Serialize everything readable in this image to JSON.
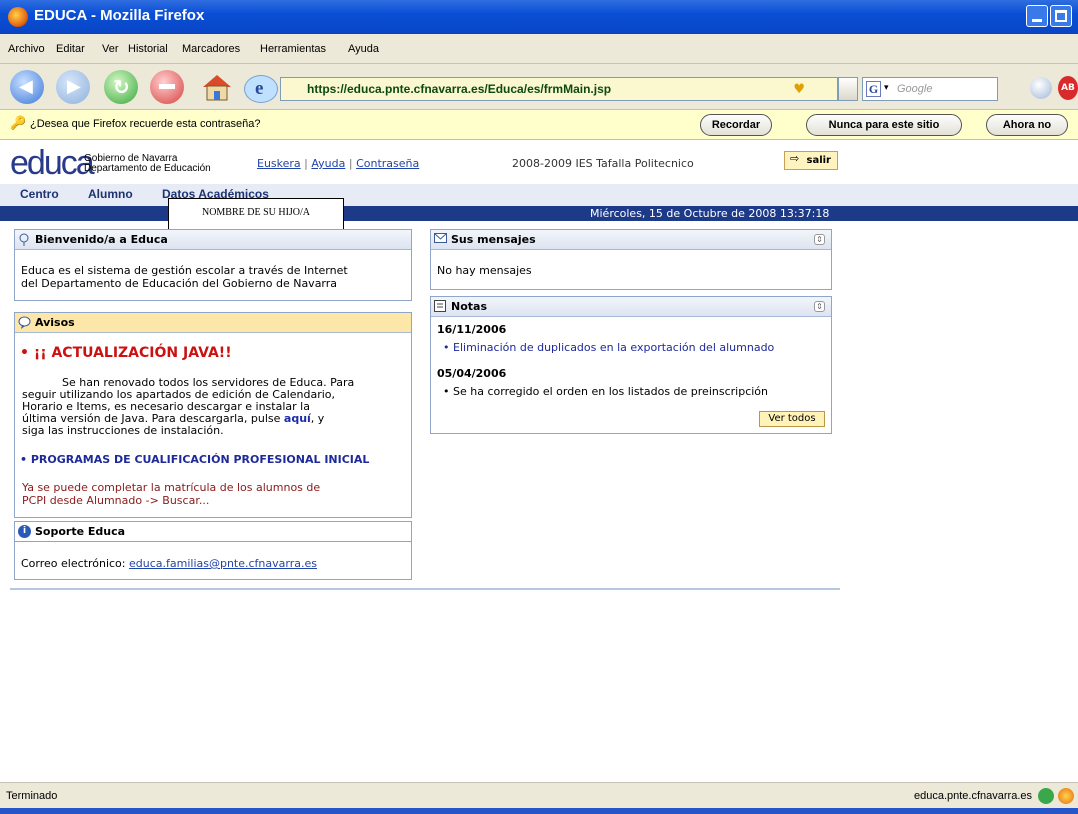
{
  "window": {
    "title": "EDUCA - Mozilla Firefox"
  },
  "menu": [
    "Archivo",
    "Editar",
    "Ver",
    "Historial",
    "Marcadores",
    "Herramientas",
    "Ayuda"
  ],
  "toolbar": {
    "url": "https://educa.pnte.cfnavarra.es/Educa/es/frmMain.jsp",
    "search_placeholder": "Google"
  },
  "password_bar": {
    "message": "¿Desea que Firefox recuerde esta contraseña?",
    "remember": "Recordar",
    "never": "Nunca para este sitio",
    "not_now": "Ahora no"
  },
  "header": {
    "logo": "educa",
    "gov_line1": "Gobierno de Navarra",
    "gov_line2": "Departamento de Educación",
    "link_euskera": "Euskera",
    "link_ayuda": "Ayuda",
    "link_password": "Contraseña",
    "school": "2008-2009 IES Tafalla Politecnico",
    "logout": "salir"
  },
  "tabs": [
    "Centro",
    "Alumno",
    "Datos Académicos"
  ],
  "child_label": "NOMBRE DE SU HIJO/A",
  "date": "Miércoles, 15 de Octubre de 2008  13:37:18",
  "welcome": {
    "title": "Bienvenido/a a Educa",
    "text1": "Educa es el sistema de gestión escolar a través de Internet",
    "text2": "del Departamento de Educación del Gobierno de Navarra"
  },
  "avisos": {
    "title": "Avisos",
    "java_title": "¡¡ ACTUALIZACIÓN JAVA!!",
    "java_l1": "Se han renovado todos los servidores de Educa. Para",
    "java_l2": "seguir utilizando los apartados de edición de Calendario,",
    "java_l3": "Horario e Items, es necesario descargar e instalar la",
    "java_l4a": "última versión de Java. Para descargarla, pulse ",
    "java_link": "aquí",
    "java_l4b": ", y",
    "java_l5": "siga las instrucciones de instalación.",
    "pcpi_title": "PROGRAMAS DE CUALIFICACIÓN PROFESIONAL INICIAL",
    "pcpi_l1": "Ya se puede completar la matrícula de los alumnos de",
    "pcpi_l2": "PCPI desde Alumnado -> Buscar..."
  },
  "support": {
    "title": "Soporte Educa",
    "label": "Correo electrónico: ",
    "email": "educa.familias@pnte.cfnavarra.es"
  },
  "messages": {
    "title": "Sus mensajes",
    "empty": "No hay mensajes"
  },
  "notes": {
    "title": "Notas",
    "items": [
      {
        "date": "16/11/2006",
        "text": "Eliminación de duplicados en la exportación del alumnado"
      },
      {
        "date": "05/04/2006",
        "text": "Se ha corregido el orden en los listados de preinscripción"
      }
    ],
    "see_all": "Ver todos"
  },
  "status": {
    "left": "Terminado",
    "right": "educa.pnte.cfnavarra.es"
  },
  "colors": {
    "title_bar": "#0a4fd6",
    "nav_bar": "#1c3a87",
    "warn_header": "#fce6a8",
    "alert_red": "#cc1111"
  }
}
